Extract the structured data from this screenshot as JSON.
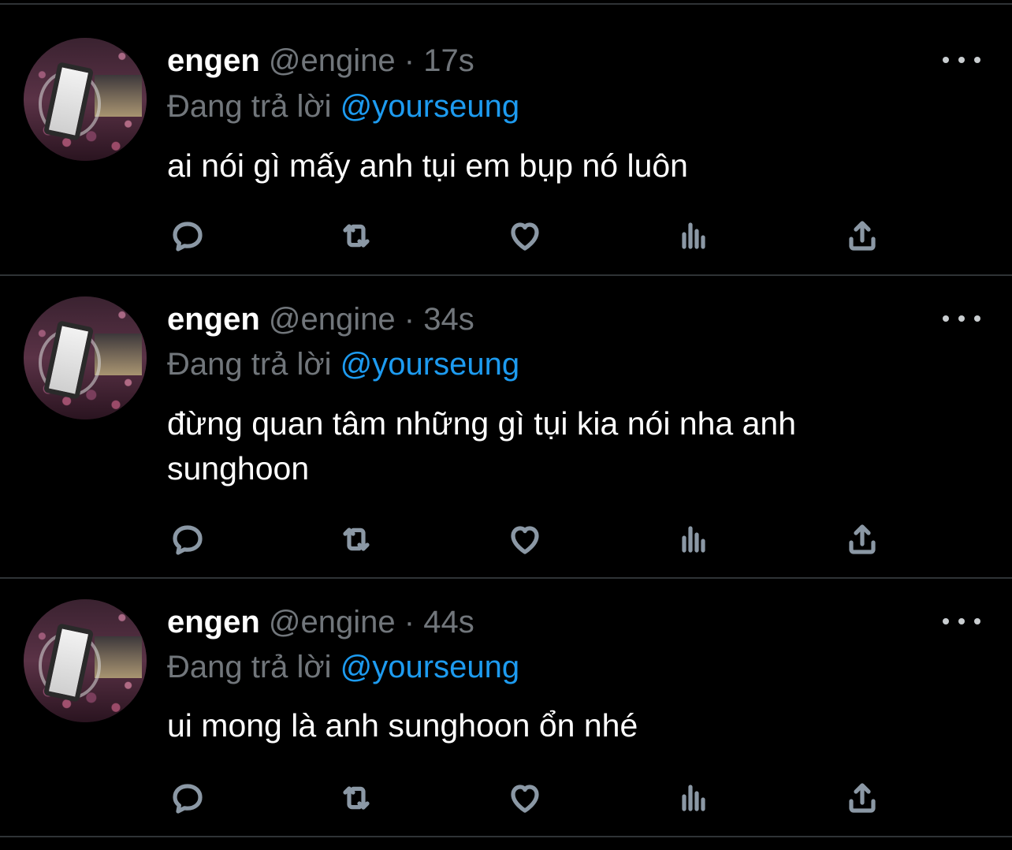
{
  "feed": {
    "tweets": [
      {
        "display_name": "engen",
        "handle": "@engine",
        "separator": "·",
        "time": "17s",
        "reply_prefix": "Đang trả lời",
        "reply_to": "@yourseung",
        "text": "ai nói gì mấy anh tụi em bụp nó luôn"
      },
      {
        "display_name": "engen",
        "handle": "@engine",
        "separator": "·",
        "time": "34s",
        "reply_prefix": "Đang trả lời",
        "reply_to": "@yourseung",
        "text": "đừng quan tâm những gì tụi kia nói nha anh sunghoon"
      },
      {
        "display_name": "engen",
        "handle": "@engine",
        "separator": "·",
        "time": "44s",
        "reply_prefix": "Đang trả lời",
        "reply_to": "@yourseung",
        "text": "ui mong là anh sunghoon ổn nhé"
      }
    ],
    "actions": [
      {
        "icon": "reply-icon"
      },
      {
        "icon": "retweet-icon"
      },
      {
        "icon": "like-icon"
      },
      {
        "icon": "analytics-icon"
      },
      {
        "icon": "share-icon"
      }
    ]
  },
  "colors": {
    "background": "#000000",
    "primary_text": "#ffffff",
    "secondary_text": "#71767b",
    "mention": "#1d9bf0",
    "divider": "#2f3336",
    "icon": "#8b98a5"
  }
}
